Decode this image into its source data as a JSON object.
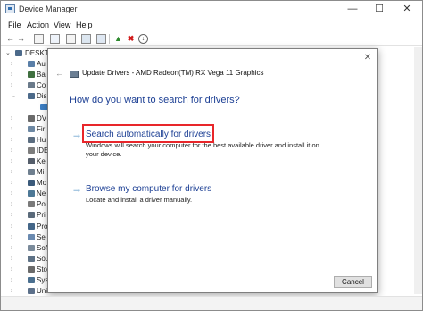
{
  "window": {
    "title": "Device Manager",
    "controls": {
      "minimize": "—",
      "maximize": "☐",
      "close": "✕"
    }
  },
  "menu": [
    "File",
    "Action",
    "View",
    "Help"
  ],
  "tree": {
    "root": "DESKTO",
    "items": [
      "Au",
      "Ba",
      "Co",
      "Dis",
      "",
      "DV",
      "Fir",
      "Hu",
      "IDE",
      "Ke",
      "Mi",
      "Mo",
      "Ne",
      "Po",
      "Pri",
      "Pro",
      "Se",
      "Sof",
      "Sou",
      "Sto",
      "Sys",
      "Uni"
    ]
  },
  "dialog": {
    "header": "Update Drivers - AMD Radeon(TM) RX Vega 11 Graphics",
    "question": "How do you want to search for drivers?",
    "options": [
      {
        "title": "Search automatically for drivers",
        "description": "Windows will search your computer for the best available driver and install it on your device."
      },
      {
        "title": "Browse my computer for drivers",
        "description": "Locate and install a driver manually."
      }
    ],
    "cancel_label": "Cancel",
    "close_glyph": "✕",
    "back_glyph": "←"
  },
  "colors": {
    "link_blue": "#1c3f94",
    "arrow_blue": "#1a6fb3",
    "highlight_red": "#e8262a"
  }
}
